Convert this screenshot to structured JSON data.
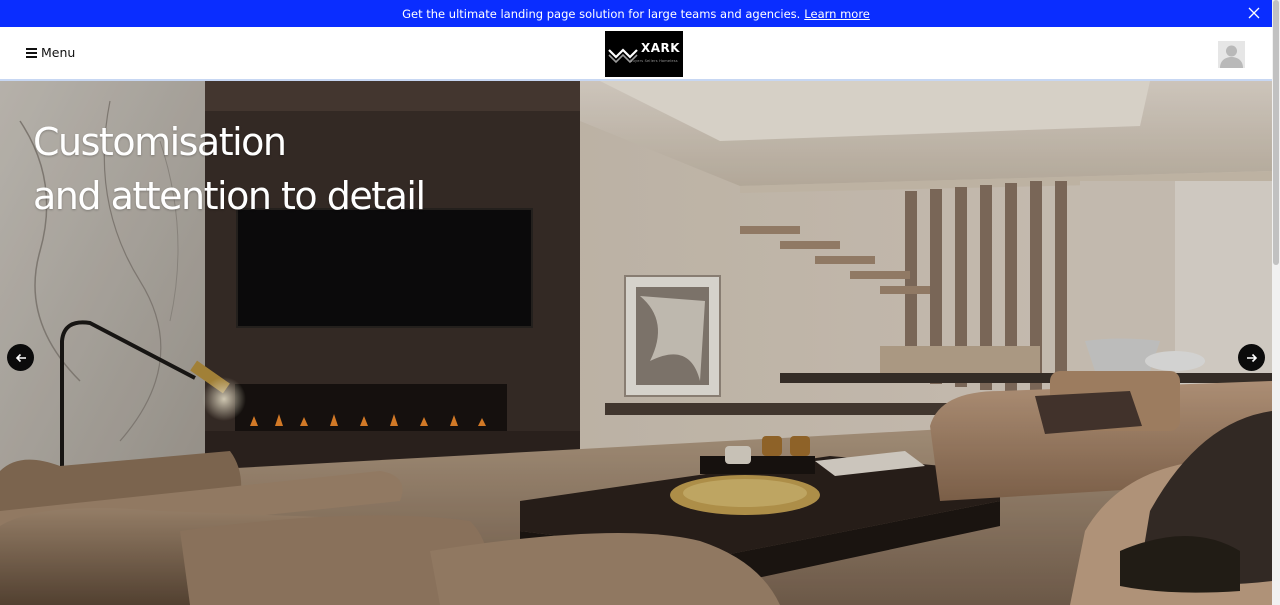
{
  "promo": {
    "text": "Get the ultimate landing page solution for large teams and agencies.",
    "link_label": "Learn more",
    "color": "#0a2dff"
  },
  "header": {
    "menu_label": "Menu",
    "logo": {
      "brand": "XARK",
      "tagline": "Buyers Sellers Homeless"
    }
  },
  "hero": {
    "title_line1": "Customisation",
    "title_line2": "and attention to detail"
  },
  "icons": [
    "menu-icon",
    "close-icon",
    "avatar-icon",
    "arrow-left-icon",
    "arrow-right-icon"
  ]
}
